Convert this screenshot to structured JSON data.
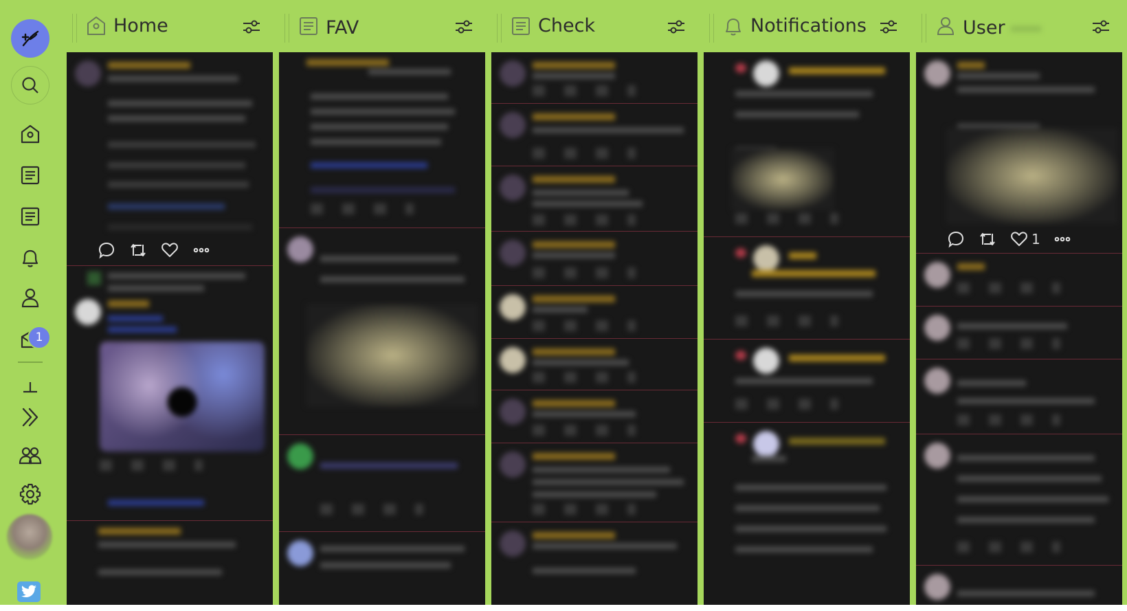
{
  "rail": {
    "notification_badge": "1",
    "items": [
      {
        "name": "compose",
        "icon": "feather-icon"
      },
      {
        "name": "search",
        "icon": "search-icon"
      },
      {
        "name": "home",
        "icon": "home-icon"
      },
      {
        "name": "list-1",
        "icon": "list-icon"
      },
      {
        "name": "list-2",
        "icon": "list-icon"
      },
      {
        "name": "notifications",
        "icon": "bell-icon"
      },
      {
        "name": "user",
        "icon": "user-icon"
      },
      {
        "name": "messages",
        "icon": "mail-icon"
      },
      {
        "name": "pin",
        "icon": "pin-icon"
      },
      {
        "name": "expand",
        "icon": "double-chevron-right-icon"
      },
      {
        "name": "accounts",
        "icon": "users-icon"
      },
      {
        "name": "settings",
        "icon": "gear-icon"
      }
    ]
  },
  "columns": [
    {
      "title": "Home",
      "icon": "home-icon"
    },
    {
      "title": "FAV",
      "icon": "list-icon"
    },
    {
      "title": "Check",
      "icon": "list-icon"
    },
    {
      "title": "Notifications",
      "icon": "bell-icon"
    },
    {
      "title": "User",
      "icon": "user-icon"
    }
  ],
  "user_column": {
    "like_count": "1"
  },
  "colors": {
    "accent_green": "#a6d75c",
    "body_dark": "#181818",
    "primary_button": "#6d7fe8",
    "divider": "#6a2a36"
  }
}
